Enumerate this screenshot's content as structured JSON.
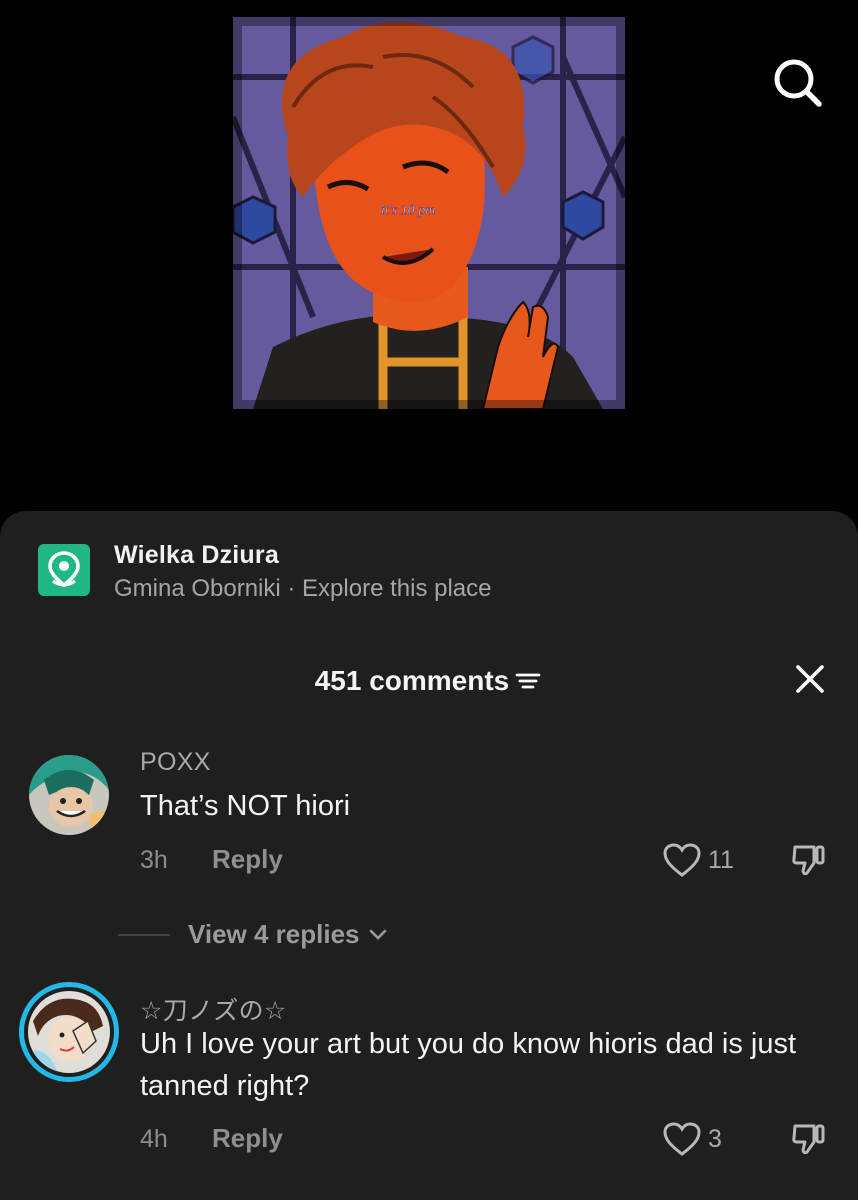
{
  "video": {
    "caption": "it's 10 pm"
  },
  "icons": {
    "search": "search-icon",
    "location": "location-pin-icon",
    "sort": "sort-icon",
    "close": "close-icon",
    "like": "heart-icon",
    "dislike": "thumbs-down-icon",
    "chevron": "chevron-down-icon"
  },
  "place": {
    "name": "Wielka Dziura",
    "subtitle": "Gmina Oborniki · Explore this place"
  },
  "comments_header": {
    "title": "451 comments"
  },
  "comments": [
    {
      "username": "POXX",
      "text": "That’s NOT hiori",
      "time": "3h",
      "reply_label": "Reply",
      "likes": "11"
    },
    {
      "username": "☆刀ノズの☆",
      "text": "Uh I love your art but you do know hioris dad is just tanned right?",
      "time": "4h",
      "reply_label": "Reply",
      "likes": "3"
    }
  ],
  "view_replies": {
    "label": "View 4 replies"
  },
  "colors": {
    "sheet_bg": "#1f1f1f",
    "place_accent": "#1fb785",
    "story_ring": "#22b8e8"
  }
}
